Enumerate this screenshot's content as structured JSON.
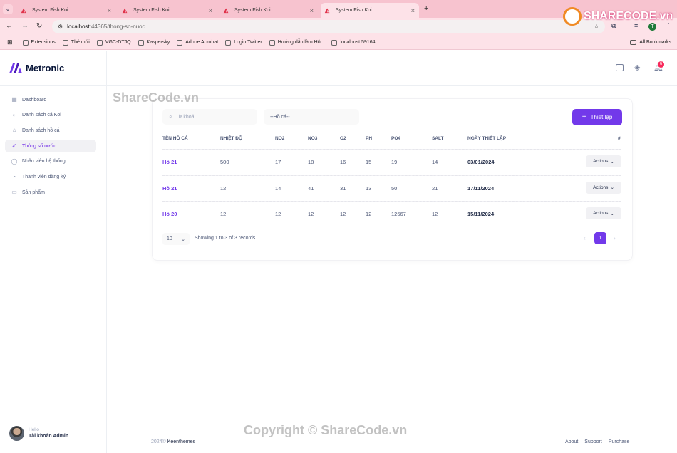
{
  "browser": {
    "tabs": [
      {
        "title": "System Fish Koi",
        "active": false
      },
      {
        "title": "System Fish Koi",
        "active": false
      },
      {
        "title": "System Fish Koi",
        "active": false
      },
      {
        "title": "System Fish Koi",
        "active": true
      }
    ],
    "url_host": "localhost",
    "url_rest": ":44365/thong-so-nuoc",
    "bookmarks": [
      "Extensions",
      "Thẻ mới",
      "VGC-DTJQ",
      "Kaspersky",
      "Adobe Acrobat",
      "Login Twitter",
      "Hướng dẫn làm Hộ...",
      "localhost:59164"
    ],
    "all_bookmarks": "All Bookmarks",
    "profile_initial": "T"
  },
  "app": {
    "brand": "Metronic",
    "notification_count": "6",
    "menu": [
      {
        "label": "Dashboard",
        "icon": "grid-icon",
        "active": false
      },
      {
        "label": "Danh sách cá Koi",
        "icon": "fish-icon",
        "active": false
      },
      {
        "label": "Danh sách hồ cá",
        "icon": "bank-icon",
        "active": false
      },
      {
        "label": "Thông số nước",
        "icon": "rocket-icon",
        "active": true
      },
      {
        "label": "Nhân viên hệ thống",
        "icon": "user-icon",
        "active": false
      },
      {
        "label": "Thành viên đăng ký",
        "icon": "user-add-icon",
        "active": false
      },
      {
        "label": "Sản phẩm",
        "icon": "basket-icon",
        "active": false
      }
    ],
    "user": {
      "greeting": "Hello",
      "name": "Tài khoản Admin"
    }
  },
  "toolbar": {
    "search_placeholder": "Từ khoá",
    "select_value": "--Hồ cá--",
    "add_label": "Thiết lập"
  },
  "table": {
    "headers": [
      "TÊN HỒ CÁ",
      "NHIỆT ĐỘ",
      "NO2",
      "NO3",
      "O2",
      "PH",
      "PO4",
      "SALT",
      "NGÀY THIẾT LẬP",
      "#"
    ],
    "rows": [
      [
        "Hồ 21",
        "500",
        "17",
        "18",
        "16",
        "15",
        "19",
        "14",
        "03/01/2024"
      ],
      [
        "Hồ 21",
        "12",
        "14",
        "41",
        "31",
        "13",
        "50",
        "21",
        "17/11/2024"
      ],
      [
        "Hồ 20",
        "12",
        "12",
        "12",
        "12",
        "12",
        "12567",
        "12",
        "15/11/2024"
      ]
    ],
    "actions_label": "Actions"
  },
  "pagination": {
    "page_size": "10",
    "info": "Showing 1 to 3 of 3 records",
    "current": "1"
  },
  "footer": {
    "year": "2024©",
    "company": "Keenthemes",
    "links": [
      "About",
      "Support",
      "Purchase"
    ]
  },
  "watermarks": {
    "top": "ShareCode.vn",
    "bottom": "Copyright © ShareCode.vn",
    "logo": "SHARECODE.vn"
  },
  "colors": {
    "accent": "#7239ea",
    "tabbar": "#f7c3cf",
    "badge": "#f8285a"
  }
}
